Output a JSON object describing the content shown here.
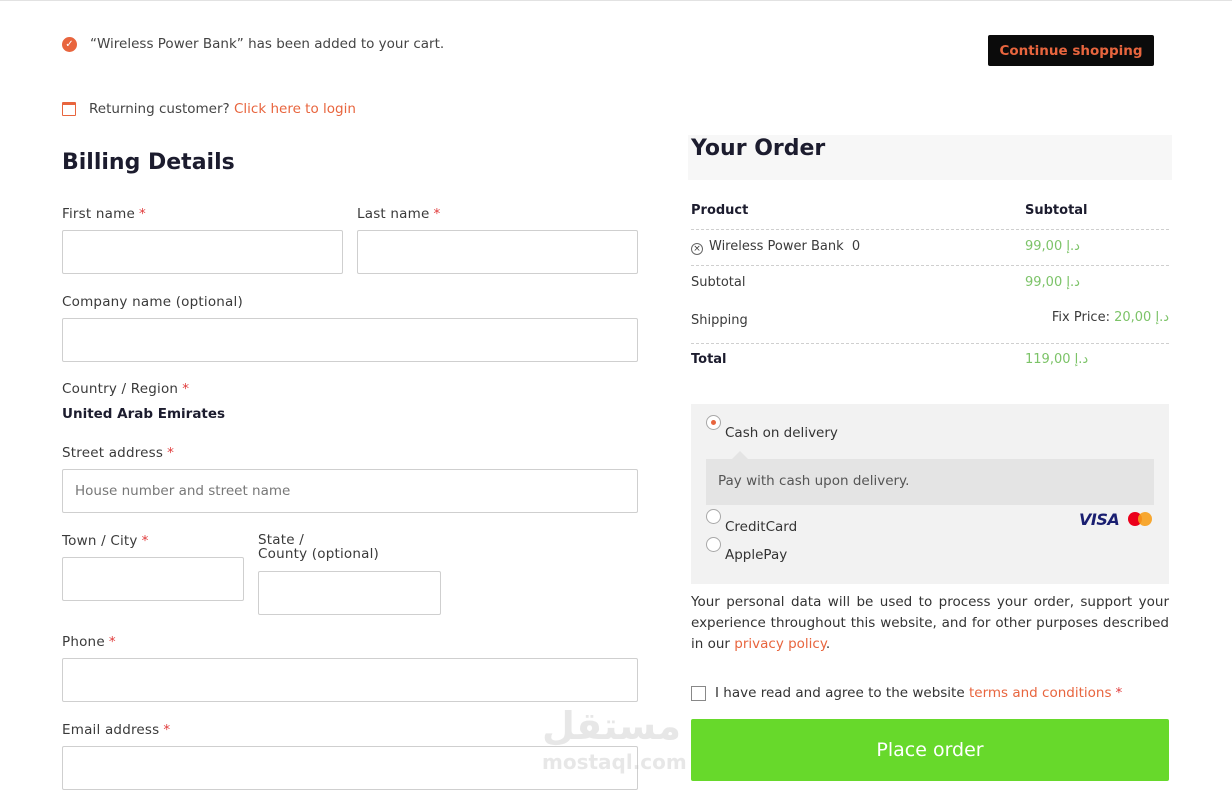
{
  "notice": {
    "message": "“Wireless Power Bank” has been added to your cart.",
    "continue_label": "Continue shopping"
  },
  "returning": {
    "text": "Returning customer?",
    "link": "Click here to login"
  },
  "billing": {
    "title": "Billing Details",
    "first_name_label": "First name",
    "last_name_label": "Last name",
    "company_label": "Company name (optional)",
    "country_label": "Country / Region",
    "country_value": "United Arab Emirates",
    "street_label": "Street address",
    "street_placeholder": "House number and street name",
    "town_label": "Town / City",
    "state_label_line1": "State /",
    "state_label_line2": "County (optional)",
    "phone_label": "Phone",
    "email_label": "Email address",
    "required_mark": "*"
  },
  "order": {
    "title": "Your Order",
    "col_product": "Product",
    "col_subtotal": "Subtotal",
    "item_name": "Wireless Power Bank",
    "item_qty": "0",
    "item_price": "99,00 د.إ",
    "subtotal_label": "Subtotal",
    "subtotal_value": "99,00 د.إ",
    "shipping_label": "Shipping",
    "shipping_method": "Fix Price:",
    "shipping_value": "20,00 د.إ",
    "total_label": "Total",
    "total_value": "119,00 د.إ"
  },
  "payment": {
    "cod_label": "Cash on delivery",
    "cod_desc": "Pay with cash upon delivery.",
    "credit_label": "CreditCard",
    "applepay_label": "ApplePay",
    "visa_text": "VISA"
  },
  "privacy": {
    "text": "Your personal data will be used to process your order, support your experience throughout this website, and for other purposes described in our",
    "link": "privacy policy",
    "end": "."
  },
  "terms": {
    "text": "I have read and agree to the website",
    "link": "terms and conditions",
    "required_mark": "*"
  },
  "place_order_label": "Place order",
  "watermark": {
    "arabic": "مستقل",
    "latin": "mostaql.com"
  },
  "colors": {
    "accent": "#e8653e",
    "price_green": "#7cc368",
    "place_button": "#67d92b"
  }
}
